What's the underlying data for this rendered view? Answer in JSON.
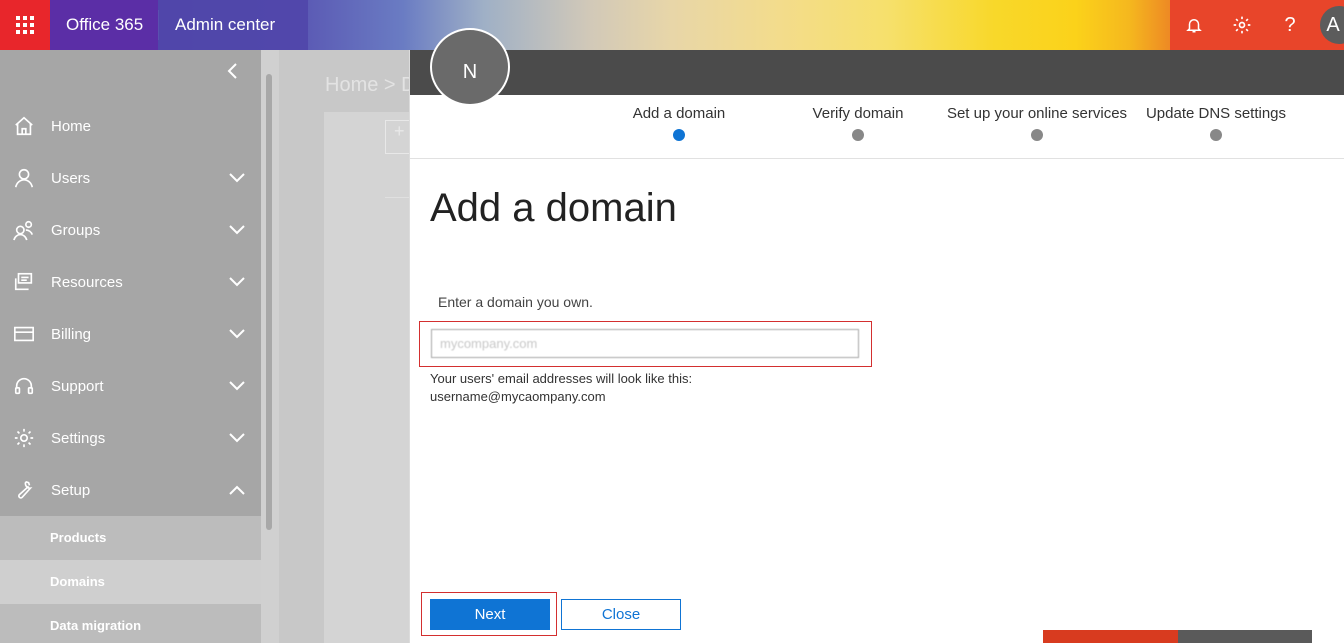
{
  "topbar": {
    "brand": "Office 365",
    "app_title": "Admin center",
    "avatar_letter": "A",
    "icons": [
      "bell-icon",
      "gear-icon",
      "help-icon"
    ],
    "help_glyph": "?"
  },
  "sidebar": {
    "items": [
      {
        "label": "Home",
        "icon": "home-icon"
      },
      {
        "label": "Users",
        "icon": "user-icon"
      },
      {
        "label": "Groups",
        "icon": "groups-icon"
      },
      {
        "label": "Resources",
        "icon": "resources-icon"
      },
      {
        "label": "Billing",
        "icon": "billing-icon"
      },
      {
        "label": "Support",
        "icon": "headset-icon"
      },
      {
        "label": "Settings",
        "icon": "gear-icon"
      },
      {
        "label": "Setup",
        "icon": "wrench-icon"
      }
    ],
    "sub_items": [
      "Products",
      "Domains",
      "Data migration"
    ]
  },
  "background": {
    "breadcrumb": "Home > D",
    "add_glyph": "+"
  },
  "panel": {
    "avatar_letter": "N",
    "steps": [
      "Add a domain",
      "Verify domain",
      "Set up your online services",
      "Update DNS settings"
    ],
    "title": "Add a domain",
    "field_label": "Enter a domain you own.",
    "domain_value": "mycompany.com",
    "hint_line1": "Your users' email addresses will look like this:",
    "hint_line2": "username@mycaompany.com",
    "next_label": "Next",
    "close_label": "Close"
  },
  "colors": {
    "accent": "#0f74d4",
    "waffle": "#e8262b",
    "brand_bg": "#5b2ea6",
    "highlight": "#d32f2f"
  }
}
